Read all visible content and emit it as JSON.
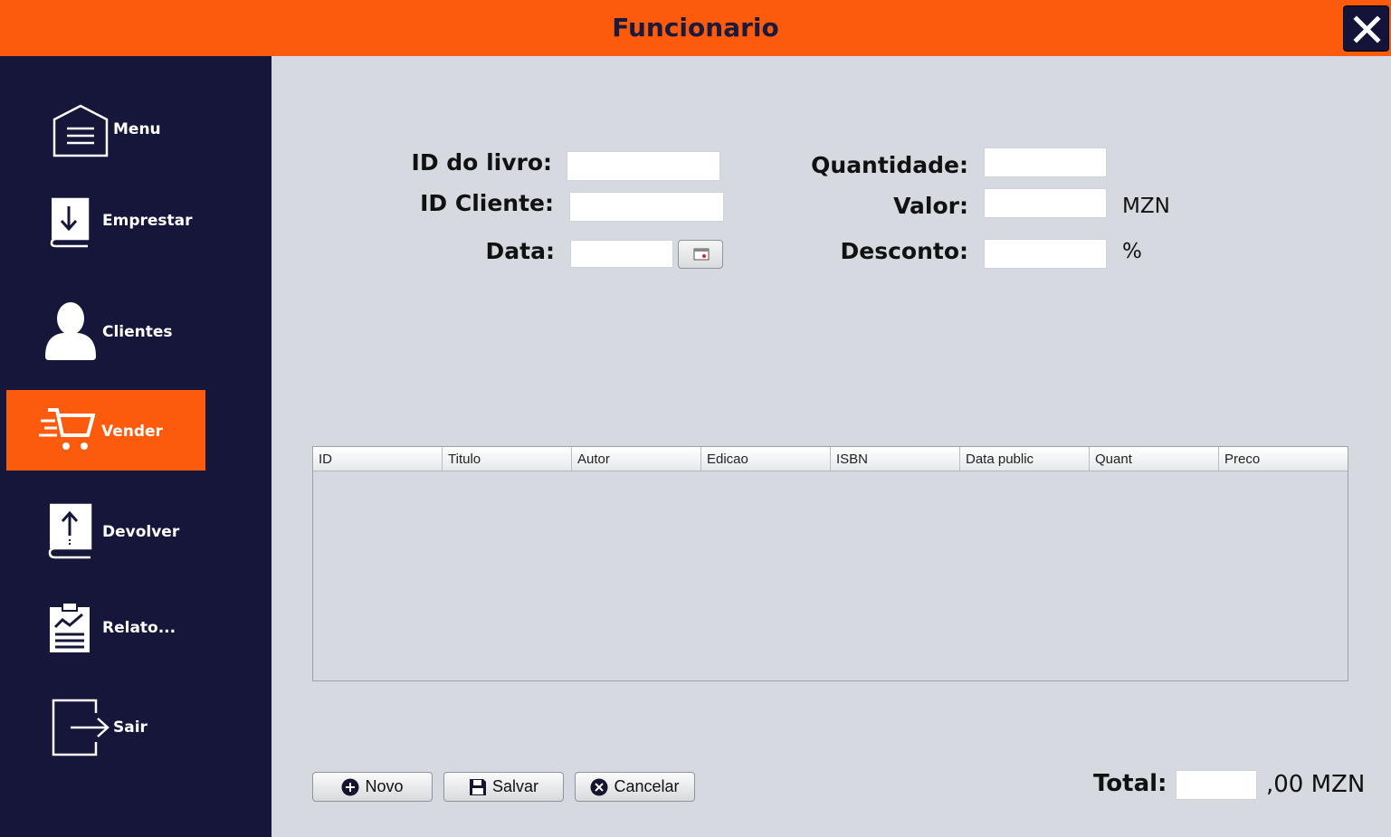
{
  "window": {
    "title": "Funcionario",
    "close_icon": "close-icon"
  },
  "sidebar": {
    "items": [
      {
        "label": "Menu",
        "icon": "home-menu-icon"
      },
      {
        "label": "Emprestar",
        "icon": "book-download-icon"
      },
      {
        "label": "Clientes",
        "icon": "user-icon"
      },
      {
        "label": "Vender",
        "icon": "shopping-cart-icon",
        "active": true
      },
      {
        "label": "Devolver",
        "icon": "book-upload-icon"
      },
      {
        "label": "Relato...",
        "icon": "report-clipboard-icon"
      },
      {
        "label": "Sair",
        "icon": "exit-icon"
      }
    ],
    "active_color": "#fc5a0c",
    "background": "#16163b"
  },
  "form": {
    "id_livro_label": "ID do livro:",
    "id_livro_value": "",
    "id_cliente_label": "ID Cliente:",
    "id_cliente_value": "",
    "data_label": "Data:",
    "data_value": "",
    "quantidade_label": "Quantidade:",
    "quantidade_value": "",
    "valor_label": "Valor:",
    "valor_value": "",
    "valor_unit": "MZN",
    "desconto_label": "Desconto:",
    "desconto_value": "",
    "desconto_unit": "%"
  },
  "table": {
    "columns": [
      "ID",
      "Titulo",
      "Autor",
      "Edicao",
      "ISBN",
      "Data public",
      "Quant",
      "Preco"
    ],
    "rows": []
  },
  "buttons": {
    "novo": "Novo",
    "salvar": "Salvar",
    "cancelar": "Cancelar"
  },
  "total": {
    "label": "Total:",
    "value": "",
    "suffix": ",00 MZN"
  },
  "colors": {
    "accent": "#fc5a0c",
    "content_bg": "#d6d9e0"
  }
}
